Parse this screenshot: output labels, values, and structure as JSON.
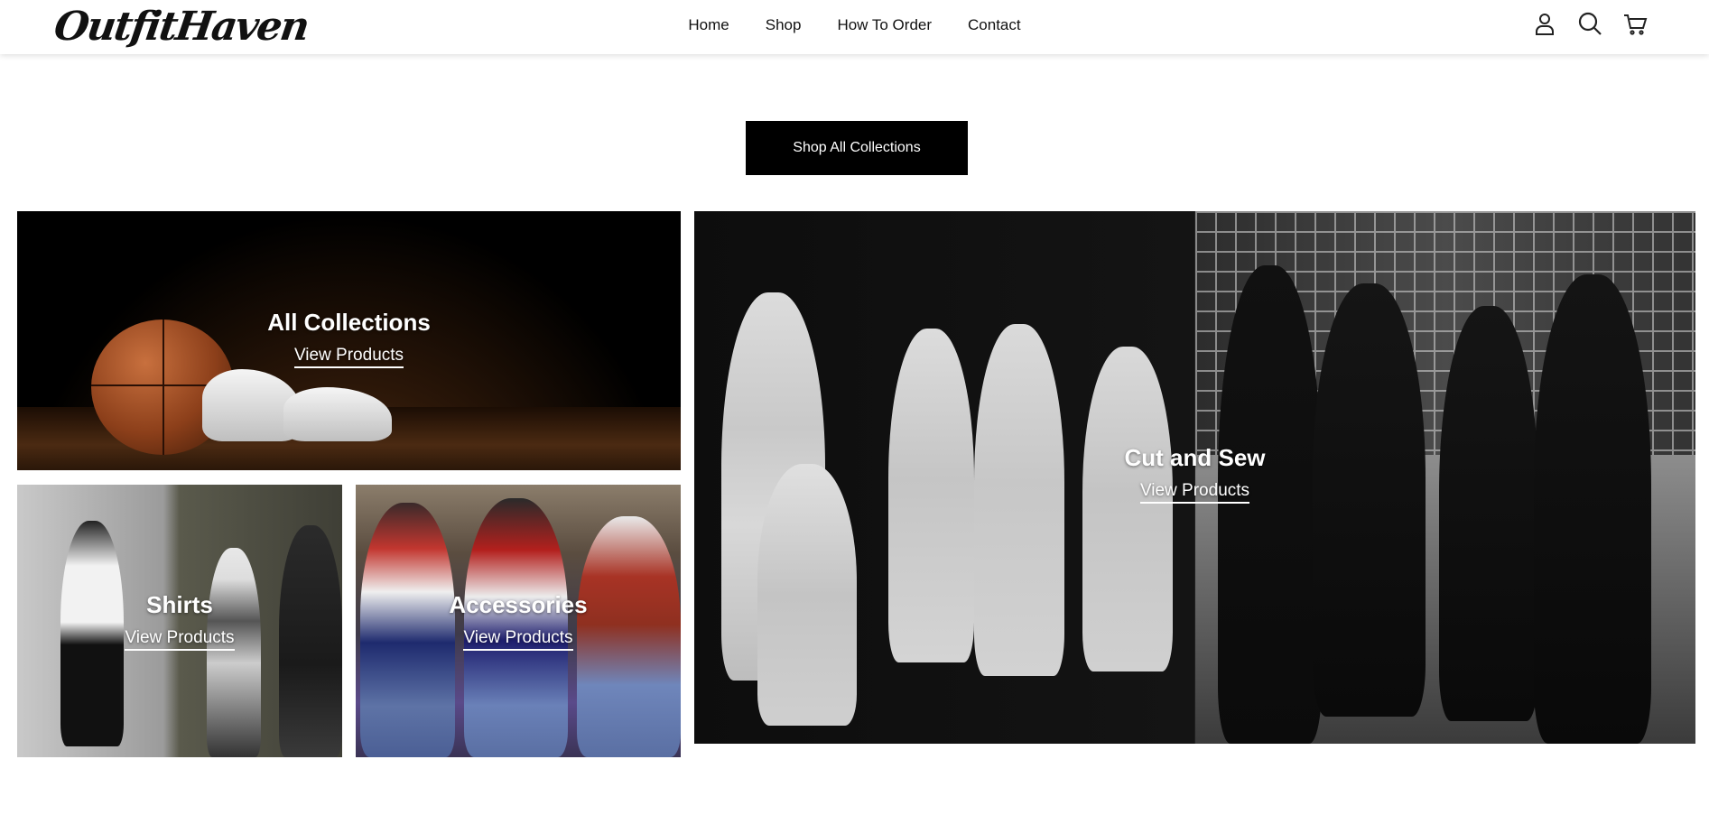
{
  "header": {
    "logo": "OutfitHaven",
    "nav": [
      "Home",
      "Shop",
      "How To Order",
      "Contact"
    ],
    "icons": [
      "account-icon",
      "search-icon",
      "cart-icon"
    ]
  },
  "cta": {
    "label": "Shop All Collections"
  },
  "tiles": {
    "all": {
      "title": "All Collections",
      "link": "View Products"
    },
    "shirts": {
      "title": "Shirts",
      "link": "View Products"
    },
    "accessories": {
      "title": "Accessories",
      "link": "View Products"
    },
    "cut": {
      "title": "Cut and Sew",
      "link": "View Products"
    }
  },
  "colors": {
    "accent": "#000000",
    "text": "#111111",
    "background": "#ffffff"
  }
}
